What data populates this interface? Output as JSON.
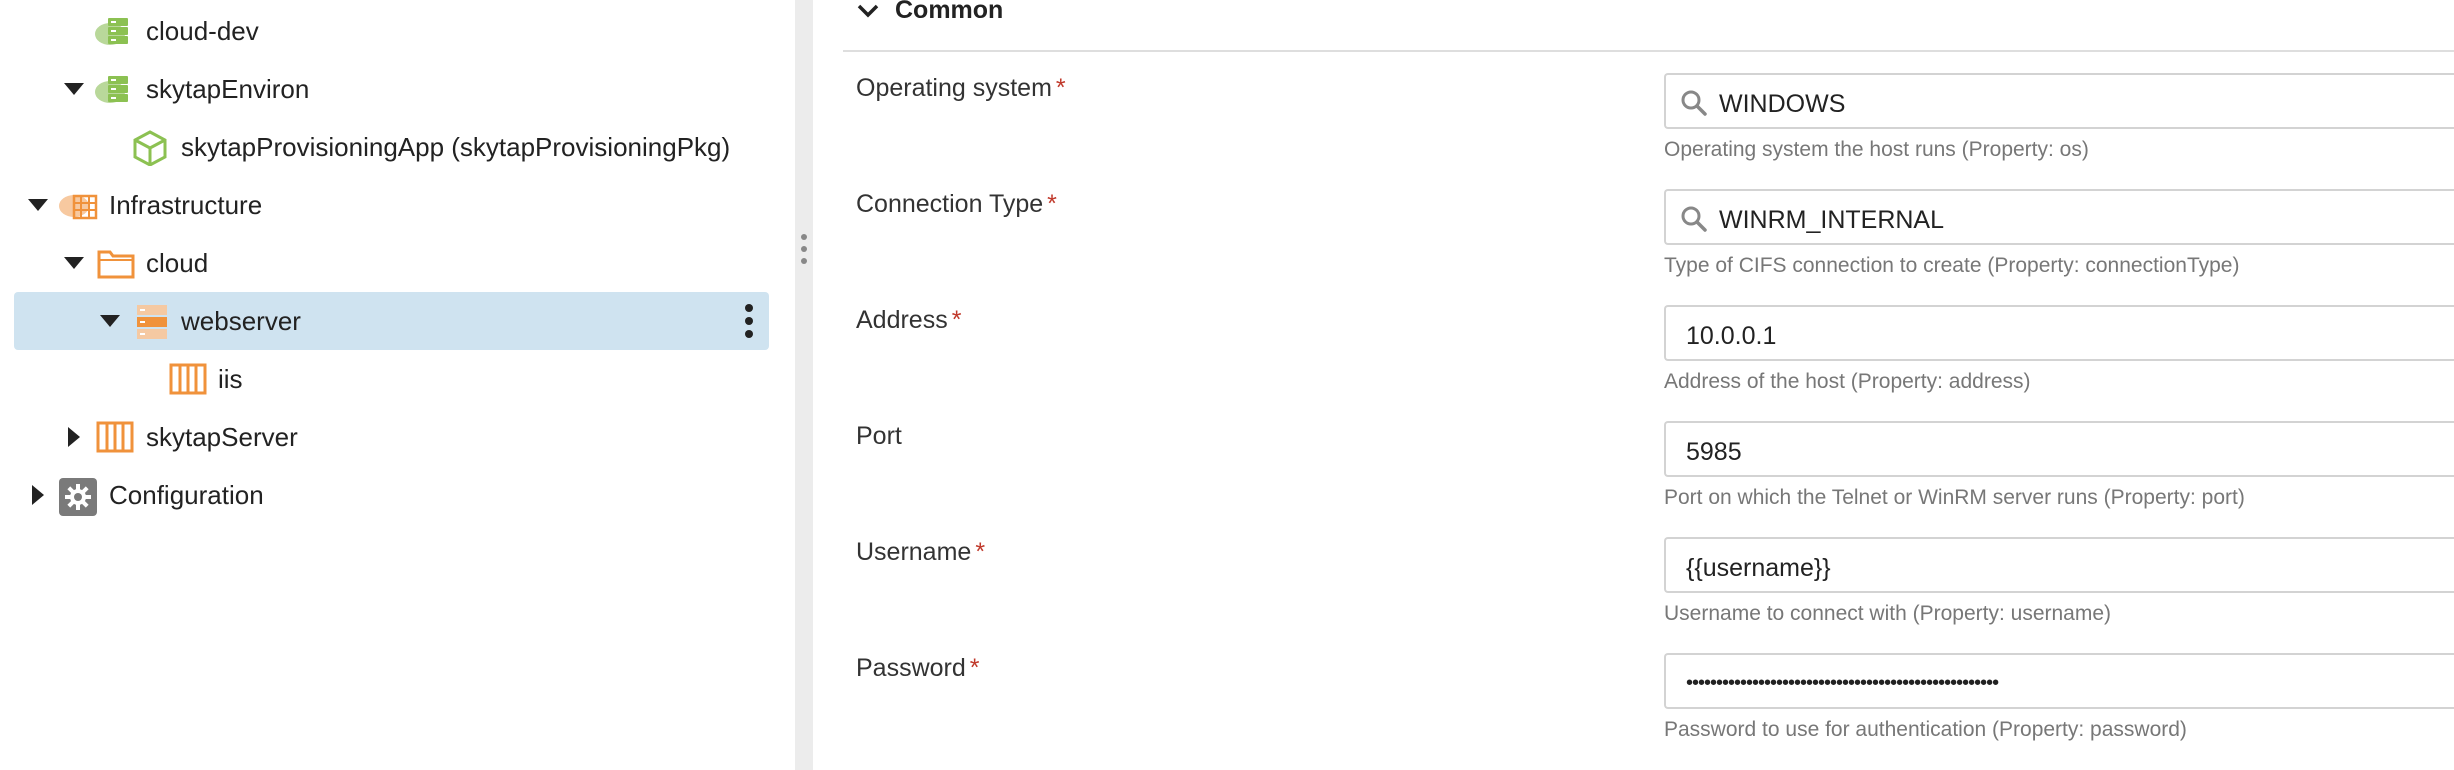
{
  "tree": {
    "items": [
      {
        "label": "cloud-dev",
        "icon": "environment-icon"
      },
      {
        "label": "skytapEnviron",
        "icon": "environment-icon"
      },
      {
        "label": "skytapProvisioningApp (skytapProvisioningPkg)",
        "icon": "package-icon"
      },
      {
        "label": "Infrastructure",
        "icon": "infrastructure-icon"
      },
      {
        "label": "cloud",
        "icon": "folder-icon"
      },
      {
        "label": "webserver",
        "icon": "server-icon"
      },
      {
        "label": "iis",
        "icon": "container-icon"
      },
      {
        "label": "skytapServer",
        "icon": "container-icon"
      },
      {
        "label": "Configuration",
        "icon": "gear-icon"
      }
    ]
  },
  "form": {
    "section_title": "Common",
    "fields": [
      {
        "label": "Operating system",
        "required": "*",
        "value": "WINDOWS",
        "help": "Operating system the host runs (Property: os)"
      },
      {
        "label": "Connection Type",
        "required": "*",
        "value": "WINRM_INTERNAL",
        "help": "Type of CIFS connection to create (Property: connectionType)"
      },
      {
        "label": "Address",
        "required": "*",
        "value": "10.0.0.1",
        "help": "Address of the host (Property: address)"
      },
      {
        "label": "Port",
        "required": "",
        "value": "5985",
        "help": "Port on which the Telnet or WinRM server runs (Property: port)"
      },
      {
        "label": "Username",
        "required": "*",
        "value": "{{username}}",
        "help": "Username to connect with (Property: username)"
      },
      {
        "label": "Password",
        "required": "*",
        "value": "••••••••••••••••••••••••••••••••••••••••••••••••••••",
        "help": "Password to use for authentication (Property: password)"
      }
    ]
  },
  "colors": {
    "selected_row": "#cfe3f0",
    "required": "#c0392b",
    "accent_orange": "#f0923b",
    "env_green": "#8cc152"
  }
}
